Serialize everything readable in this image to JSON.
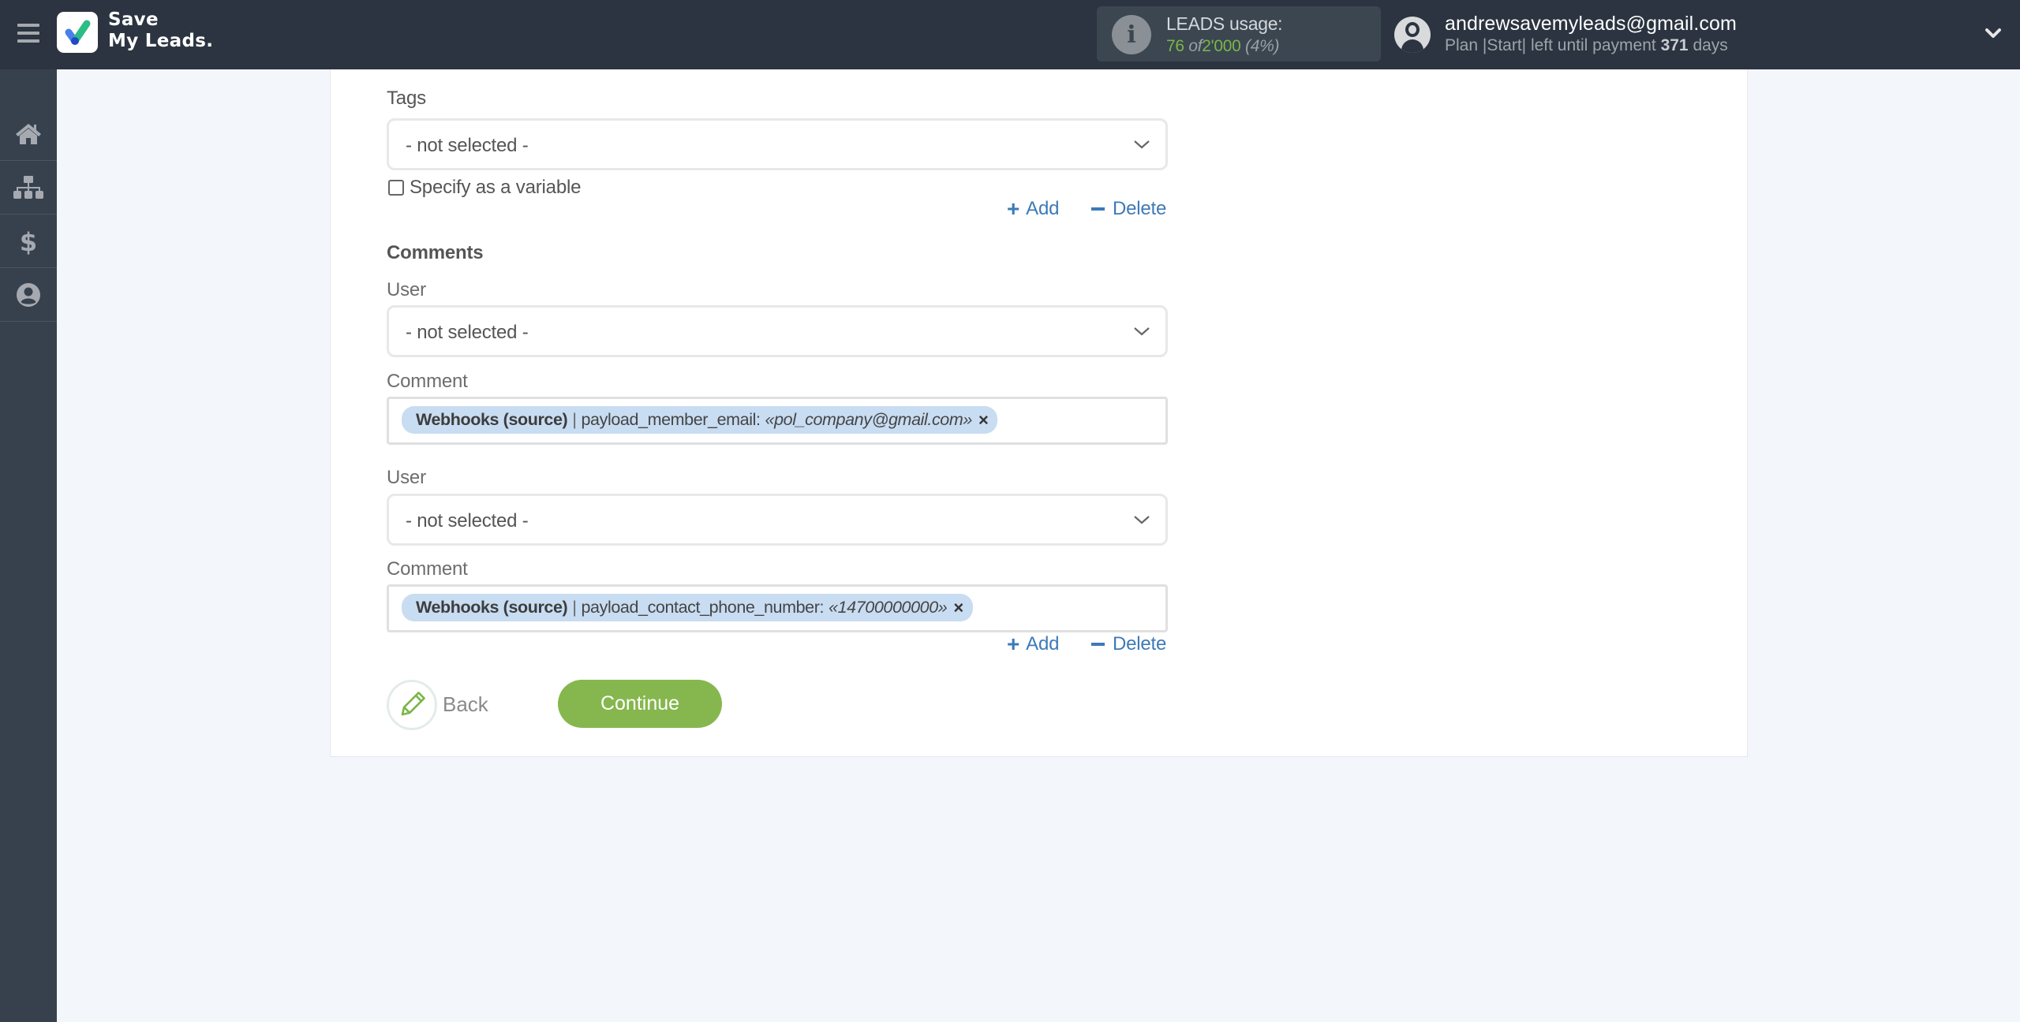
{
  "header": {
    "logo_line1": "Save",
    "logo_line2": "My Leads.",
    "usage": {
      "title": "LEADS usage:",
      "used": "76",
      "of_label": "of",
      "total": "2'000",
      "percent": "(4%)"
    },
    "user": {
      "email": "andrewsavemyleads@gmail.com",
      "plan_prefix": "Plan |Start| left until payment",
      "days": "371",
      "days_suffix": "days"
    }
  },
  "sidebar": {
    "items": [
      {
        "name": "home",
        "icon": "home-icon"
      },
      {
        "name": "connections",
        "icon": "sitemap-icon"
      },
      {
        "name": "billing",
        "icon": "dollar-icon"
      },
      {
        "name": "account",
        "icon": "user-circle-icon"
      }
    ]
  },
  "form": {
    "tags": {
      "label": "Tags",
      "value": "- not selected -",
      "checkbox_label": "Specify as a variable",
      "checked": false
    },
    "add_label": "Add",
    "delete_label": "Delete",
    "comments_title": "Comments",
    "comments": [
      {
        "user_label": "User",
        "user_value": "- not selected -",
        "comment_label": "Comment",
        "tag": {
          "source": "Webhooks (source)",
          "separator": "|",
          "field": "payload_member_email:",
          "value": "«pol_company@gmail.com»",
          "remove": "×"
        }
      },
      {
        "user_label": "User",
        "user_value": "- not selected -",
        "comment_label": "Comment",
        "tag": {
          "source": "Webhooks (source)",
          "separator": "|",
          "field": "payload_contact_phone_number:",
          "value": "«14700000000»",
          "remove": "×"
        }
      }
    ],
    "back_label": "Back",
    "continue_label": "Continue"
  },
  "colors": {
    "header_bg": "#2b3440",
    "sidebar_bg": "#37414e",
    "accent_green": "#86b74e",
    "link_blue": "#3d7ab8",
    "tag_bg": "#c8dcf2"
  }
}
